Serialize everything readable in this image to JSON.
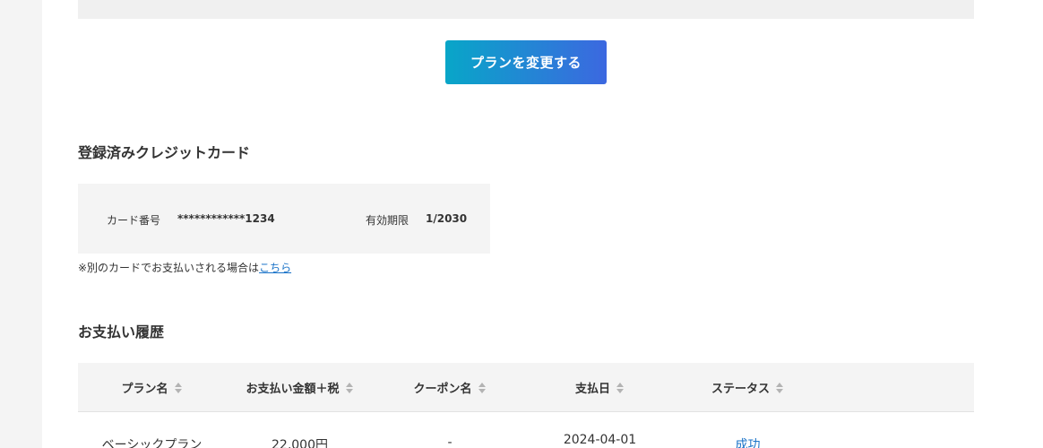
{
  "plan": {
    "change_button": "プランを変更する"
  },
  "card_section": {
    "title": "登録済みクレジットカード",
    "card_number_label": "カード番号",
    "card_number_value": "************1234",
    "expiry_label": "有効期限",
    "expiry_value": "1/2030",
    "note_prefix": "※別のカードでお支払いされる場合は",
    "note_link": "こちら"
  },
  "payment_history": {
    "title": "お支払い履歴",
    "columns": [
      "プラン名",
      "お支払い金額＋税",
      "クーポン名",
      "支払日",
      "ステータス"
    ],
    "rows": [
      {
        "plan": "ベーシックプラン",
        "amount": "22,000円",
        "coupon": "-",
        "date": "2024-04-01",
        "status": "成功"
      }
    ]
  },
  "colors": {
    "button_gradient_start": "#08a6c8",
    "button_gradient_end": "#3c68e0",
    "link": "#1a73c8"
  }
}
